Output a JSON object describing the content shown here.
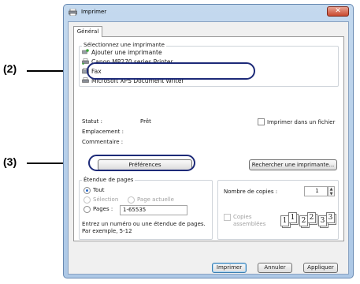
{
  "callouts": [
    {
      "label": "(2)"
    },
    {
      "label": "(3)"
    }
  ],
  "window": {
    "title": "Imprimer",
    "close_glyph": "✕"
  },
  "tabs": [
    {
      "label": "Général"
    }
  ],
  "printer_select": {
    "group_label": "Sélectionnez une imprimante",
    "items": [
      {
        "label": "Ajouter une imprimante",
        "icon": "add-printer-icon"
      },
      {
        "label": "Canon MP270 series Printer",
        "icon": "printer-icon",
        "selected": true
      },
      {
        "label": "Fax",
        "icon": "fax-icon"
      },
      {
        "label": "Microsoft XPS Document Writer",
        "icon": "printer-icon"
      }
    ],
    "status_label": "Statut :",
    "status_value": "Prêt",
    "location_label": "Emplacement :",
    "comment_label": "Commentaire :",
    "print_to_file_label": "Imprimer dans un fichier",
    "preferences_button": "Préférences",
    "find_printer_button": "Rechercher une imprimante..."
  },
  "page_range": {
    "group_label": "Étendue de pages",
    "all_label": "Tout",
    "selection_label": "Sélection",
    "current_page_label": "Page actuelle",
    "pages_label": "Pages :",
    "pages_value": "1-65535",
    "hint_text": "Entrez un numéro ou une étendue de pages. Par exemple, 5-12"
  },
  "copies": {
    "count_label": "Nombre de copies :",
    "count_value": "1",
    "collate_label": "Copies assemblées",
    "collate_pages": [
      "1",
      "1",
      "2",
      "2",
      "3",
      "3"
    ]
  },
  "buttons": {
    "print": "Imprimer",
    "cancel": "Annuler",
    "apply": "Appliquer"
  },
  "colors": {
    "callout_ring": "#1d2a78",
    "title_gradient_top": "#c4d9ee",
    "close_red": "#c9492f"
  }
}
